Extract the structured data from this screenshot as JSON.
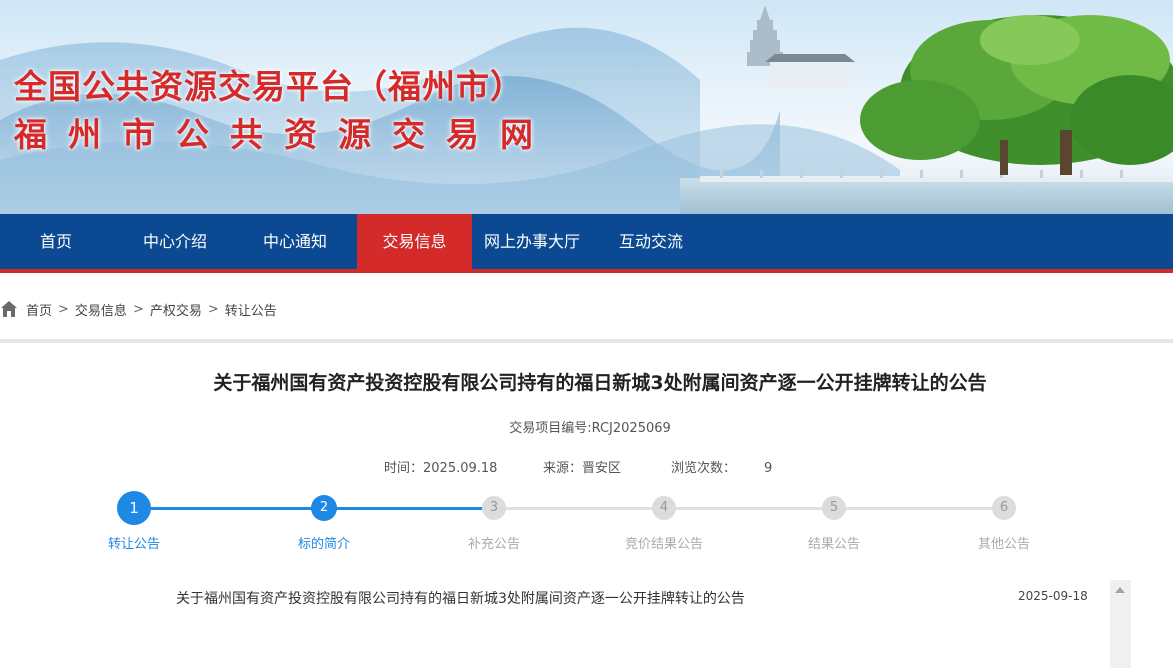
{
  "header": {
    "title_line1": "全国公共资源交易平台（福州市）",
    "title_line2": "福州市公共资源交易网"
  },
  "nav": {
    "items": [
      "首页",
      "中心介绍",
      "中心通知",
      "交易信息",
      "网上办事大厅",
      "互动交流"
    ],
    "active_index": 3
  },
  "breadcrumb": {
    "home_icon": "home-icon",
    "separator": ">",
    "items": [
      "首页",
      "交易信息",
      "产权交易",
      "转让公告"
    ]
  },
  "article": {
    "title": "关于福州国有资产投资控股有限公司持有的福日新城3处附属间资产逐一公开挂牌转让的公告",
    "project_no": "交易项目编号:RCJ2025069",
    "time_label": "时间：",
    "time": "2025.09.18",
    "source_label": "来源：",
    "source": "晋安区",
    "views_label": "浏览次数：",
    "views": "9"
  },
  "steps": {
    "items": [
      {
        "num": "1",
        "label": "转让公告"
      },
      {
        "num": "2",
        "label": "标的简介"
      },
      {
        "num": "3",
        "label": "补充公告"
      },
      {
        "num": "4",
        "label": "竞价结果公告"
      },
      {
        "num": "5",
        "label": "结果公告"
      },
      {
        "num": "6",
        "label": "其他公告"
      }
    ],
    "current": 2
  },
  "list": {
    "items": [
      {
        "title": "关于福州国有资产投资控股有限公司持有的福日新城3处附属间资产逐一公开挂牌转让的公告",
        "date": "2025-09-18"
      }
    ]
  },
  "colors": {
    "nav_bg": "#0b4a92",
    "accent_red": "#d42a2a",
    "step_blue": "#1e88e5"
  }
}
